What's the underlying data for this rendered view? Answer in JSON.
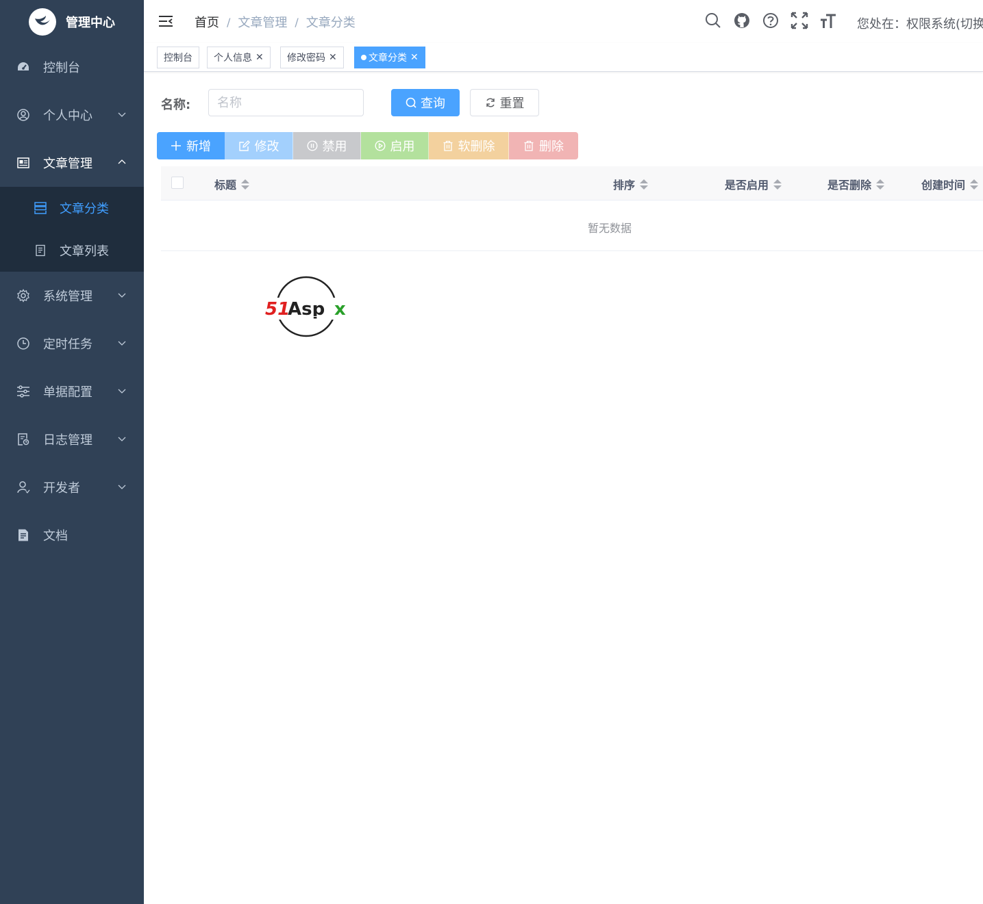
{
  "sidebar": {
    "brand": "管理中心",
    "items": [
      {
        "label": "控制台",
        "icon": "dashboard-icon"
      },
      {
        "label": "个人中心",
        "icon": "user-icon"
      },
      {
        "label": "文章管理",
        "icon": "article-icon"
      },
      {
        "label": "系统管理",
        "icon": "gear-icon"
      },
      {
        "label": "定时任务",
        "icon": "clock-icon"
      },
      {
        "label": "单据配置",
        "icon": "sliders-icon"
      },
      {
        "label": "日志管理",
        "icon": "log-icon"
      },
      {
        "label": "开发者",
        "icon": "developer-icon"
      },
      {
        "label": "文档",
        "icon": "document-icon"
      }
    ],
    "submenu": [
      {
        "label": "文章分类",
        "icon": "list-icon"
      },
      {
        "label": "文章列表",
        "icon": "page-icon"
      }
    ]
  },
  "header": {
    "breadcrumb": [
      "首页",
      "文章管理",
      "文章分类"
    ],
    "separator": "/",
    "location": "您处在：权限系统(切换"
  },
  "tags": [
    {
      "label": "控制台"
    },
    {
      "label": "个人信息"
    },
    {
      "label": "修改密码"
    },
    {
      "label": "文章分类"
    }
  ],
  "search": {
    "label": "名称:",
    "placeholder": "名称",
    "query_label": "查询",
    "reset_label": "重置"
  },
  "toolbar": {
    "add": "新增",
    "edit": "修改",
    "disable": "禁用",
    "enable": "启用",
    "soft_delete": "软删除",
    "delete": "删除"
  },
  "table": {
    "columns": [
      "标题",
      "排序",
      "是否启用",
      "是否删除",
      "创建时间"
    ],
    "empty_text": "暂无数据"
  },
  "colors": {
    "sidebar_bg": "#304156",
    "submenu_bg": "#1f2d3d",
    "primary": "#4aa3ff",
    "active_text": "#409eff"
  }
}
